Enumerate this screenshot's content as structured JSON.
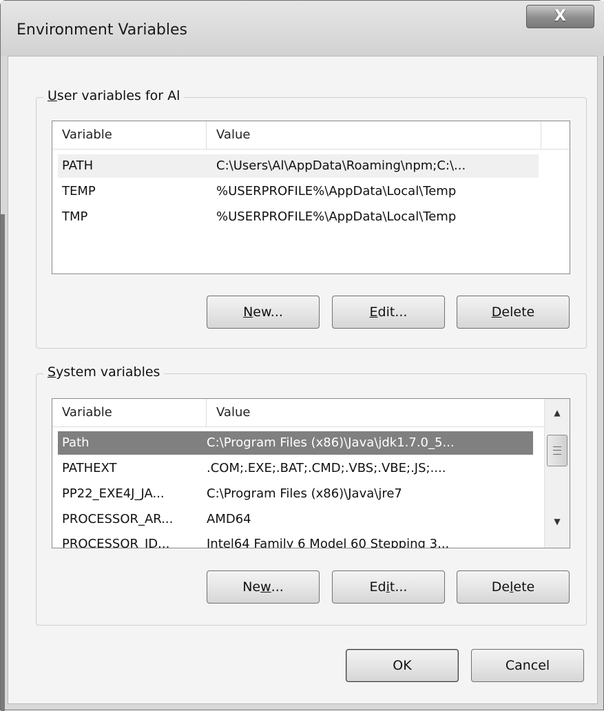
{
  "window": {
    "title": "Environment Variables",
    "close_glyph": "X"
  },
  "user_section": {
    "title_prefix": "",
    "title_mnemonic": "U",
    "title_rest": "ser variables for Al",
    "columns": [
      "Variable",
      "Value"
    ],
    "rows": [
      {
        "variable": "PATH",
        "value": "C:\\Users\\Al\\AppData\\Roaming\\npm;C:\\..."
      },
      {
        "variable": "TEMP",
        "value": "%USERPROFILE%\\AppData\\Local\\Temp"
      },
      {
        "variable": "TMP",
        "value": "%USERPROFILE%\\AppData\\Local\\Temp"
      }
    ],
    "buttons": {
      "new": {
        "pre": "",
        "key": "N",
        "post": "ew..."
      },
      "edit": {
        "pre": "",
        "key": "E",
        "post": "dit..."
      },
      "delete": {
        "pre": "",
        "key": "D",
        "post": "elete"
      }
    }
  },
  "system_section": {
    "title_prefix": "",
    "title_mnemonic": "S",
    "title_rest": "ystem variables",
    "columns": [
      "Variable",
      "Value"
    ],
    "rows": [
      {
        "variable": "Path",
        "value": "C:\\Program Files (x86)\\Java\\jdk1.7.0_5..."
      },
      {
        "variable": "PATHEXT",
        "value": ".COM;.EXE;.BAT;.CMD;.VBS;.VBE;.JS;...."
      },
      {
        "variable": "PP22_EXE4J_JA...",
        "value": "C:\\Program Files (x86)\\Java\\jre7"
      },
      {
        "variable": "PROCESSOR_AR...",
        "value": "AMD64"
      },
      {
        "variable": "PROCESSOR_ID...",
        "value": "Intel64 Family 6 Model 60 Stepping 3..."
      }
    ],
    "buttons": {
      "new": {
        "pre": "Ne",
        "key": "w",
        "post": "..."
      },
      "edit": {
        "pre": "Ed",
        "key": "i",
        "post": "t..."
      },
      "delete": {
        "pre": "De",
        "key": "l",
        "post": "ete"
      }
    }
  },
  "dialog_buttons": {
    "ok": "OK",
    "cancel": "Cancel"
  },
  "icons": {
    "scroll_up": "scroll-up-arrow-icon",
    "scroll_down": "scroll-down-arrow-icon",
    "grip": "scroll-grip-icon"
  },
  "colors": {
    "selected_row": "#808080",
    "window_chrome": "#d8d8d8"
  }
}
